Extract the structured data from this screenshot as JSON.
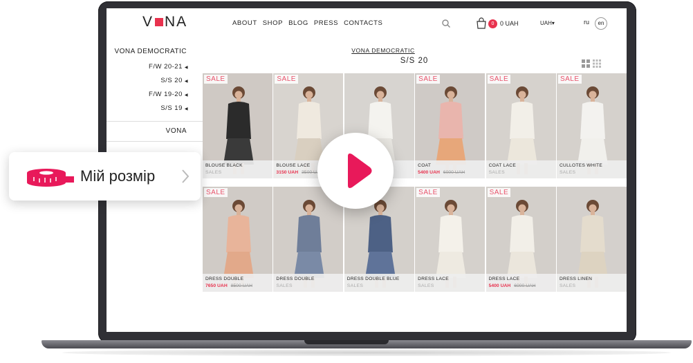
{
  "brand": {
    "logo_left": "V",
    "logo_right": "NA",
    "accent": "#e8324e"
  },
  "nav": [
    {
      "label": "ABOUT"
    },
    {
      "label": "SHOP"
    },
    {
      "label": "BLOG"
    },
    {
      "label": "PRESS"
    },
    {
      "label": "CONTACTS"
    }
  ],
  "cart": {
    "count": "0",
    "total": "0 UAH"
  },
  "currency": "UAH▾",
  "lang": {
    "ru": "ru",
    "en": "en"
  },
  "sidebar": {
    "title": "VONA DEMOCRATIC",
    "items": [
      {
        "label": "F/W 20-21"
      },
      {
        "label": "S/S 20"
      },
      {
        "label": "F/W 19-20"
      },
      {
        "label": "S/S 19"
      }
    ],
    "section": "VONA",
    "arrow": "◀"
  },
  "breadcrumb": "VONA DEMOCRATIC",
  "season": "S/S 20",
  "sale_label": "SALE",
  "products": [
    {
      "name": "BLOUSE BLACK",
      "price": "",
      "old": "",
      "tag": "SALES",
      "sale": true,
      "bg": "#cfc9c4",
      "outfit": "#2b2b2b",
      "skirt": "#3a3a3a"
    },
    {
      "name": "BLOUSE LACE",
      "price": "3150 UAH",
      "old": "3500 UAH",
      "tag": "",
      "sale": true,
      "bg": "#d8d4cf",
      "outfit": "#efe9df",
      "skirt": "#d9cfc0"
    },
    {
      "name": "",
      "price": "",
      "old": "",
      "tag": "",
      "sale": false,
      "bg": "#d7d4d0",
      "outfit": "#f4f3ef",
      "skirt": "#e8e6e1"
    },
    {
      "name": "COAT",
      "price": "5400 UAH",
      "old": "6000 UAH",
      "tag": "",
      "sale": true,
      "bg": "#cfcac6",
      "outfit": "#e9b5ad",
      "skirt": "#e7a77a"
    },
    {
      "name": "COAT LACE",
      "price": "",
      "old": "",
      "tag": "SALES",
      "sale": true,
      "bg": "#d6d2cd",
      "outfit": "#f2efe8",
      "skirt": "#ece7dc"
    },
    {
      "name": "CULLOTES WHITE",
      "price": "",
      "old": "",
      "tag": "SALES",
      "sale": true,
      "bg": "#d5d1cc",
      "outfit": "#f3f2ef",
      "skirt": "#f1f0ec"
    },
    {
      "name": "DRESS DOUBLE",
      "price": "7650 UAH",
      "old": "8500 UAH",
      "tag": "",
      "sale": true,
      "bg": "#d0cbc6",
      "outfit": "#e8b49a",
      "skirt": "#e2a98a"
    },
    {
      "name": "DRESS DOUBLE",
      "price": "",
      "old": "",
      "tag": "SALES",
      "sale": false,
      "bg": "#d2cdc8",
      "outfit": "#6f7e99",
      "skirt": "#7a8aa6"
    },
    {
      "name": "DRESS DOUBLE BLUE",
      "price": "",
      "old": "",
      "tag": "SALES",
      "sale": false,
      "bg": "#d4d0cb",
      "outfit": "#4d6185",
      "skirt": "#5f7399"
    },
    {
      "name": "DRESS LACE",
      "price": "",
      "old": "",
      "tag": "SALES",
      "sale": true,
      "bg": "#d5d1cc",
      "outfit": "#f4f1ea",
      "skirt": "#eeeae1"
    },
    {
      "name": "DRESS LACE",
      "price": "5400 UAH",
      "old": "6000 UAH",
      "tag": "",
      "sale": true,
      "bg": "#d3cfca",
      "outfit": "#f2efe8",
      "skirt": "#ebe6dc"
    },
    {
      "name": "DRESS LINEN",
      "price": "",
      "old": "",
      "tag": "SALES",
      "sale": false,
      "bg": "#d4d0cc",
      "outfit": "#e4dccd",
      "skirt": "#ddd3c1"
    }
  ],
  "size_card": {
    "label": "Мій розмір",
    "color": "#e8195a"
  },
  "play_color": "#e8195a"
}
